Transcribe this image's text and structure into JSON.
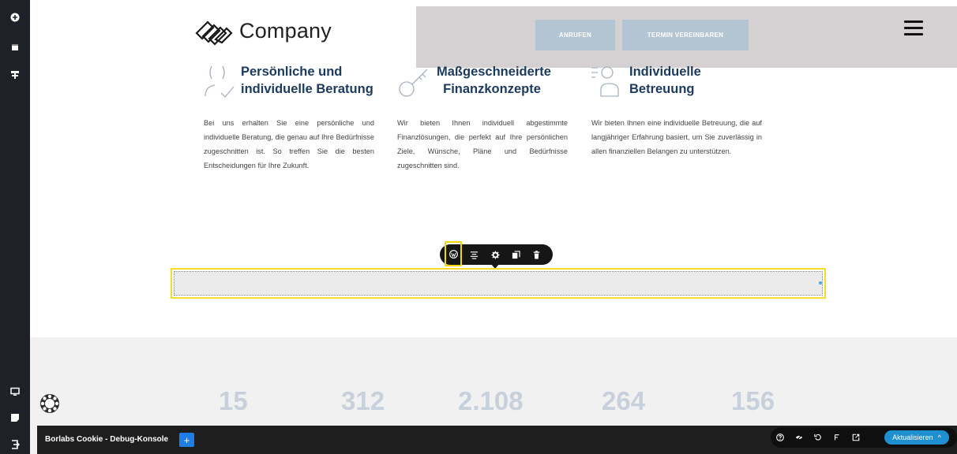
{
  "header": {
    "logo_text": "Company",
    "call_button": "ANRUFEN",
    "appointment_button": "TERMIN VEREINBAREN"
  },
  "features": [
    {
      "title_line1": "Persönliche und",
      "title_line2": "individuelle Beratung",
      "body": "Bei uns erhalten Sie eine persönliche und individuelle Beratung, die genau auf Ihre Bedürfnisse zugeschnitten ist. So treffen Sie die besten Entscheidungen für Ihre Zukunft."
    },
    {
      "title_line1": "Maßgeschneiderte",
      "title_line2": "Finanzkonzepte",
      "body": "Wir bieten Ihnen individuell abgestimmte Finanzlösungen, die perfekt auf Ihre persönlichen Ziele, Wünsche, Pläne und Bedürfnisse zugeschnitten sind."
    },
    {
      "title_line1": "Individuelle",
      "title_line2": "Betreuung",
      "body": "Wir bieten Ihnen eine individuelle Betreuung, die auf langjähriger Erfahrung basiert, um Sie zuverlässig in allen finanziellen Belangen zu unterstützen."
    }
  ],
  "stats": [
    "15",
    "312",
    "2.108",
    "264",
    "156"
  ],
  "debug": {
    "title": "Borlabs Cookie - Debug-Konsole",
    "plus": "+",
    "update_button": "Aktualisieren",
    "update_chevron": "^"
  },
  "colors": {
    "sidebar": "#1e2228",
    "accent_yellow": "#f5dc2a",
    "header_button": "#b3c4d3",
    "feature_title": "#1c3a5e",
    "stat_number": "#c8d0dc",
    "update_button": "#1e8fcf"
  },
  "icons": {
    "left_toolbar": [
      "add-icon",
      "page-icon",
      "structure-icon",
      "desktop-preview-icon",
      "template-icon",
      "exit-icon"
    ],
    "block_toolbar": [
      "wordpress-icon",
      "align-icon",
      "settings-icon",
      "duplicate-icon",
      "delete-icon"
    ],
    "bottom_toolbar": [
      "help-icon",
      "hide-icon",
      "undo-icon",
      "history-icon",
      "external-link-icon"
    ]
  }
}
